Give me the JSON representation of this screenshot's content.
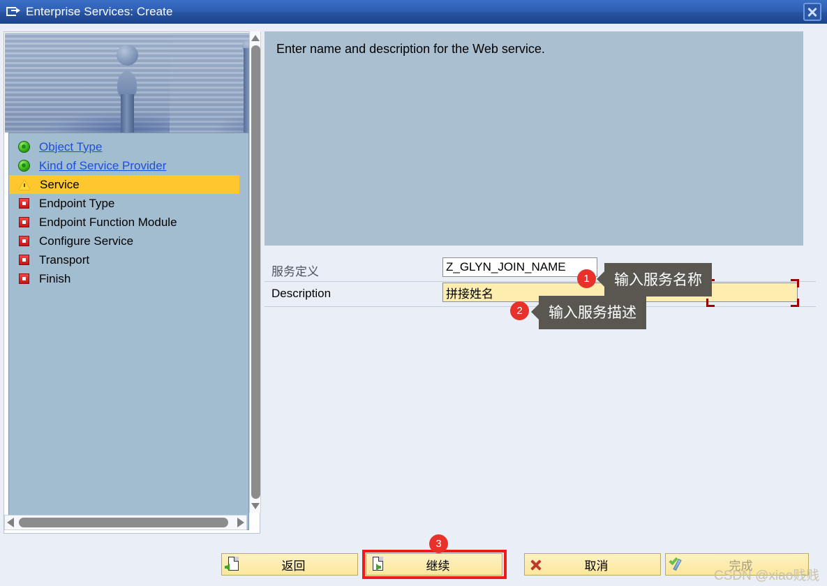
{
  "window": {
    "title": "Enterprise Services: Create",
    "icon": "window-create-icon",
    "close_label": "✕"
  },
  "roadmap": {
    "items": [
      {
        "label": "Object Type",
        "state": "done",
        "link": true
      },
      {
        "label": "Kind of Service Provider",
        "state": "done",
        "link": true
      },
      {
        "label": "Service",
        "state": "current",
        "link": false
      },
      {
        "label": "Endpoint Type",
        "state": "todo",
        "link": false
      },
      {
        "label": "Endpoint Function Module",
        "state": "todo",
        "link": false
      },
      {
        "label": "Configure Service",
        "state": "todo",
        "link": false
      },
      {
        "label": "Transport",
        "state": "todo",
        "link": false
      },
      {
        "label": "Finish",
        "state": "todo",
        "link": false
      }
    ]
  },
  "instructions": {
    "text": "Enter name and description for the Web service."
  },
  "form": {
    "service_definition": {
      "label": "服务定义",
      "value": "Z_GLYN_JOIN_NAME",
      "placeholder": ""
    },
    "description": {
      "label": "Description",
      "value": "拼接姓名",
      "placeholder": ""
    }
  },
  "annotations": [
    {
      "number": "1",
      "text": "输入服务名称"
    },
    {
      "number": "2",
      "text": "输入服务描述"
    },
    {
      "number": "3",
      "text": ""
    }
  ],
  "footer": {
    "buttons": [
      {
        "label": "返回",
        "icon": "document-back-icon",
        "disabled": false
      },
      {
        "label": "继续",
        "icon": "document-next-icon",
        "disabled": false
      },
      {
        "label": "取消",
        "icon": "cancel-x-icon",
        "disabled": false
      },
      {
        "label": "完成",
        "icon": "check-pen-icon",
        "disabled": true
      }
    ]
  },
  "watermark": {
    "text": "CSDN @xiao贱贱"
  },
  "colors": {
    "titlebar": "#27539f",
    "accent_highlight": "#ffc72e",
    "badge": "#e8312a",
    "callout": "#595750",
    "panel": "#aabfd0",
    "focus_corner": "#a00000"
  }
}
